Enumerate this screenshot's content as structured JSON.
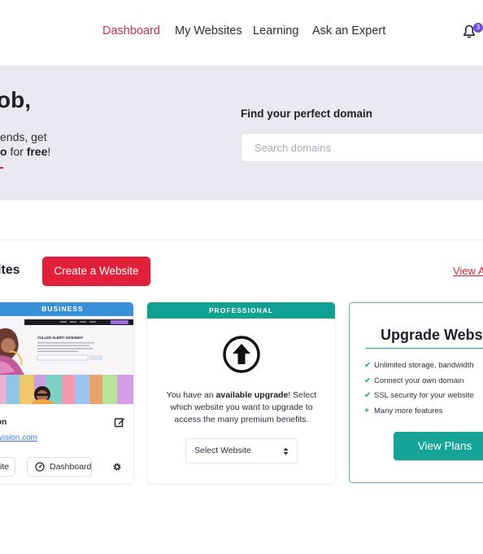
{
  "nav": {
    "items": [
      {
        "label": "Dashboard",
        "active": true
      },
      {
        "label": "My Websites",
        "active": false
      },
      {
        "label": "Learning",
        "active": false
      },
      {
        "label": "Ask an Expert",
        "active": false
      }
    ],
    "notification_count": "3"
  },
  "hero": {
    "greeting": "ob,",
    "line1": "ends, get",
    "line2_bold": "o",
    "line2_mid": " for ",
    "line2_free": "free",
    "line2_end": "!",
    "find_label": "Find your perfect domain",
    "search_placeholder": "Search domains"
  },
  "sites": {
    "title": "ites",
    "create_label": "Create a Website",
    "view_all_label": "View A"
  },
  "cards": {
    "site": {
      "plan": "BUSINESS",
      "thumb_headline": "CULLED ALERT! GIVEAWAY",
      "name": "on",
      "url": "tvision.com",
      "site_button": "Site",
      "dashboard_button": "Dashboard"
    },
    "upgrade": {
      "plan": "PROFESSIONAL",
      "text_before": "You have an ",
      "text_bold": "available upgrade",
      "text_after": "! Select which website you want to upgrade to access the many premium benefits.",
      "select_label": "Select Website"
    },
    "plans": {
      "title": "Upgrade Webs",
      "features": [
        {
          "marker": "✔",
          "text": "Unlimited storage, bandwidth"
        },
        {
          "marker": "✔",
          "text": "Connect your own domain"
        },
        {
          "marker": "✔",
          "text": "SSL security for your website"
        },
        {
          "marker": "+",
          "text": "Many more features"
        }
      ],
      "button_label": "View Plans"
    }
  },
  "colors": {
    "brand_red": "#e3203a",
    "nav_active": "#c0344d",
    "business_blue": "#3a8fd9",
    "teal": "#14a394",
    "hero_bg": "#e9e9f1",
    "badge_purple": "#6c4fd8"
  }
}
